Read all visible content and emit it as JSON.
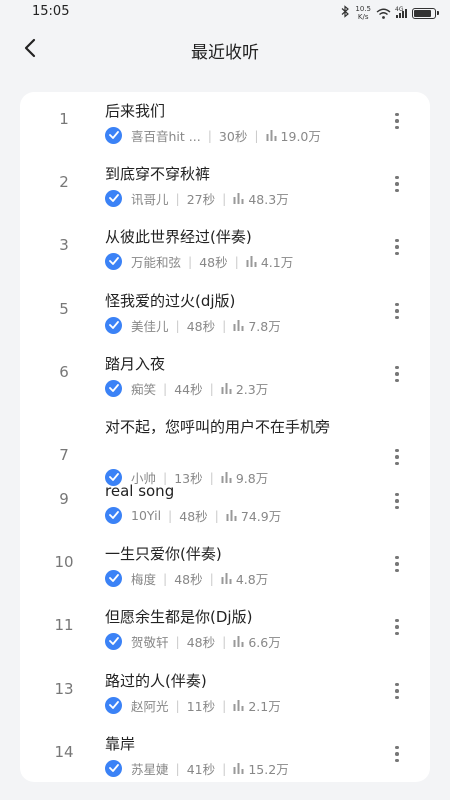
{
  "status": {
    "time": "15:05",
    "speed_value": "10.5",
    "speed_unit": "K/s",
    "network": "4G"
  },
  "header": {
    "title": "最近收听"
  },
  "songs": [
    {
      "rank": "1",
      "title": "后来我们",
      "artist": "喜百音hit ...",
      "duration": "30秒",
      "plays": "19.0万"
    },
    {
      "rank": "2",
      "title": "到底穿不穿秋裤",
      "artist": "讯哥儿",
      "duration": "27秒",
      "plays": "48.3万"
    },
    {
      "rank": "3",
      "title": "从彼此世界经过(伴奏)",
      "artist": "万能和弦",
      "duration": "48秒",
      "plays": "4.1万"
    },
    {
      "rank": "5",
      "title": "怪我爱的过火(dj版)",
      "artist": "美佳儿",
      "duration": "48秒",
      "plays": "7.8万"
    },
    {
      "rank": "6",
      "title": "踏月入夜",
      "artist": "痴笑",
      "duration": "44秒",
      "plays": "2.3万"
    },
    {
      "rank": "7",
      "title": "对不起，您呼叫的用户不在手机旁",
      "artist": "小帅",
      "duration": "13秒",
      "plays": "9.8万"
    },
    {
      "rank": "9",
      "title": "real song",
      "artist": "10Yil",
      "duration": "48秒",
      "plays": "74.9万"
    },
    {
      "rank": "10",
      "title": "一生只爱你(伴奏)",
      "artist": "梅度",
      "duration": "48秒",
      "plays": "4.8万"
    },
    {
      "rank": "11",
      "title": "但愿余生都是你(Dj版)",
      "artist": "贺敬轩",
      "duration": "48秒",
      "plays": "6.6万"
    },
    {
      "rank": "13",
      "title": "路过的人(伴奏)",
      "artist": "赵阿光",
      "duration": "11秒",
      "plays": "2.1万"
    },
    {
      "rank": "14",
      "title": "靠岸",
      "artist": "苏星婕",
      "duration": "41秒",
      "plays": "15.2万"
    }
  ],
  "colors": {
    "accent": "#3b82f6",
    "background": "#f3f4f6",
    "card": "#ffffff"
  },
  "icons": {
    "back": "chevron-left-icon",
    "verified": "check-circle-icon",
    "plays": "bar-chart-icon",
    "more": "more-vertical-icon"
  }
}
